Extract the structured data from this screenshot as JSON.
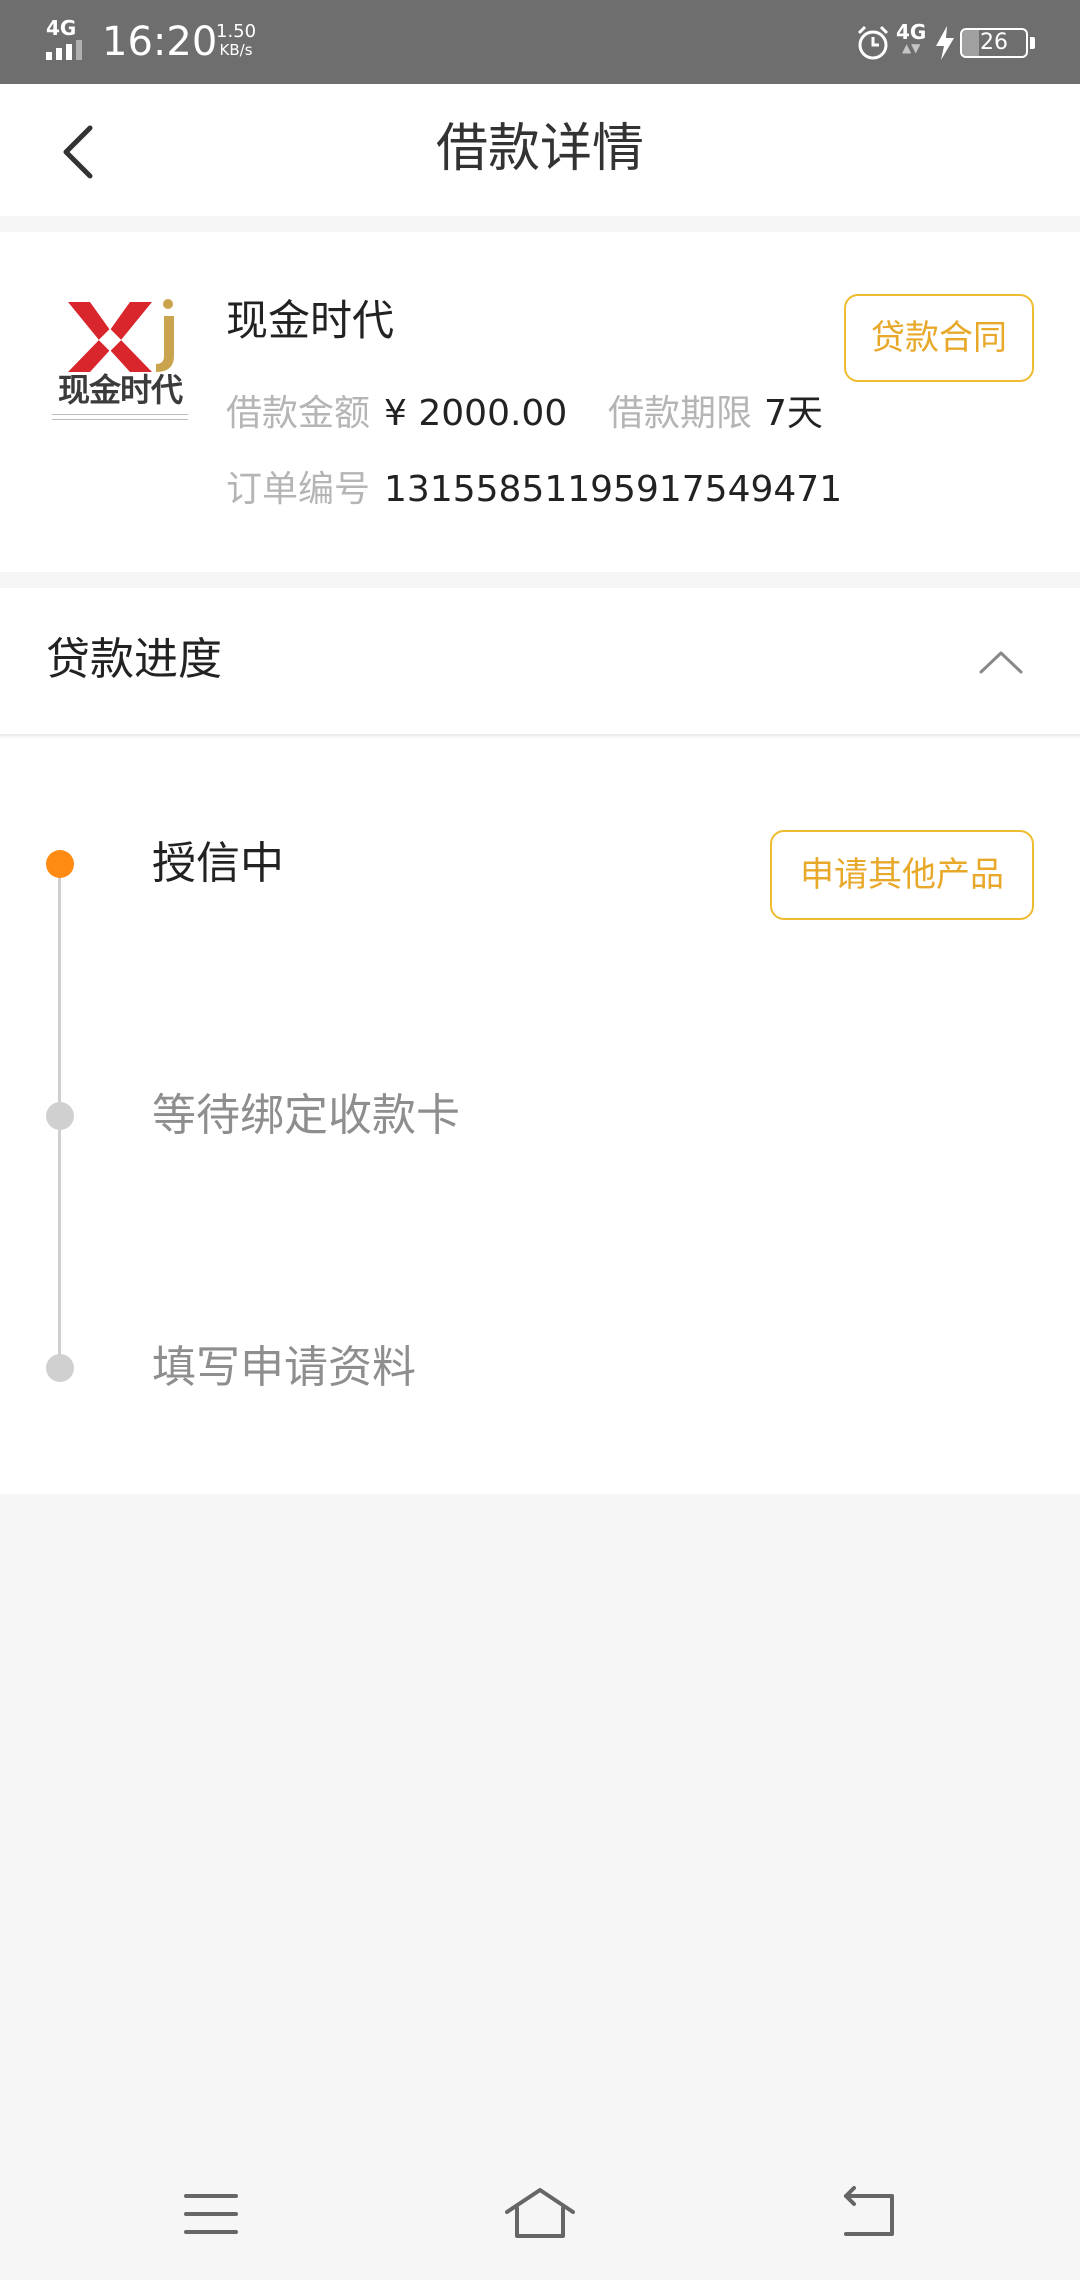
{
  "status_bar": {
    "network": "4G",
    "time": "16:20",
    "speed_value": "1.50",
    "speed_unit": "KB/s",
    "network2": "4G",
    "battery_level": "26",
    "battery_fraction": 0.26
  },
  "header": {
    "title": "借款详情"
  },
  "loan": {
    "logo_text": "现金时代",
    "product_name": "现金时代",
    "amount_label": "借款金额",
    "amount_value": "¥ 2000.00",
    "term_label": "借款期限",
    "term_value": "7天",
    "order_label": "订单编号",
    "order_value": "1315585119591754947​1",
    "contract_button": "贷款合同"
  },
  "progress": {
    "title": "贷款进度",
    "apply_other_button": "申请其他产品",
    "steps": [
      {
        "label": "授信中",
        "state": "active"
      },
      {
        "label": "等待绑定收款卡",
        "state": "pending"
      },
      {
        "label": "填写申请资料",
        "state": "pending"
      }
    ]
  },
  "colors": {
    "accent": "#efbb2f",
    "accent_text": "#e8a92a",
    "active_dot": "#ff8b12",
    "pending_dot": "#d0d0d0",
    "status_bar_bg": "#6e6e6e",
    "page_bg": "#f6f6f6"
  },
  "icons": {
    "back": "chevron-left-icon",
    "collapse": "chevron-up-icon",
    "nav_menu": "menu-icon",
    "nav_home": "home-icon",
    "nav_back": "back-arrow-icon"
  }
}
